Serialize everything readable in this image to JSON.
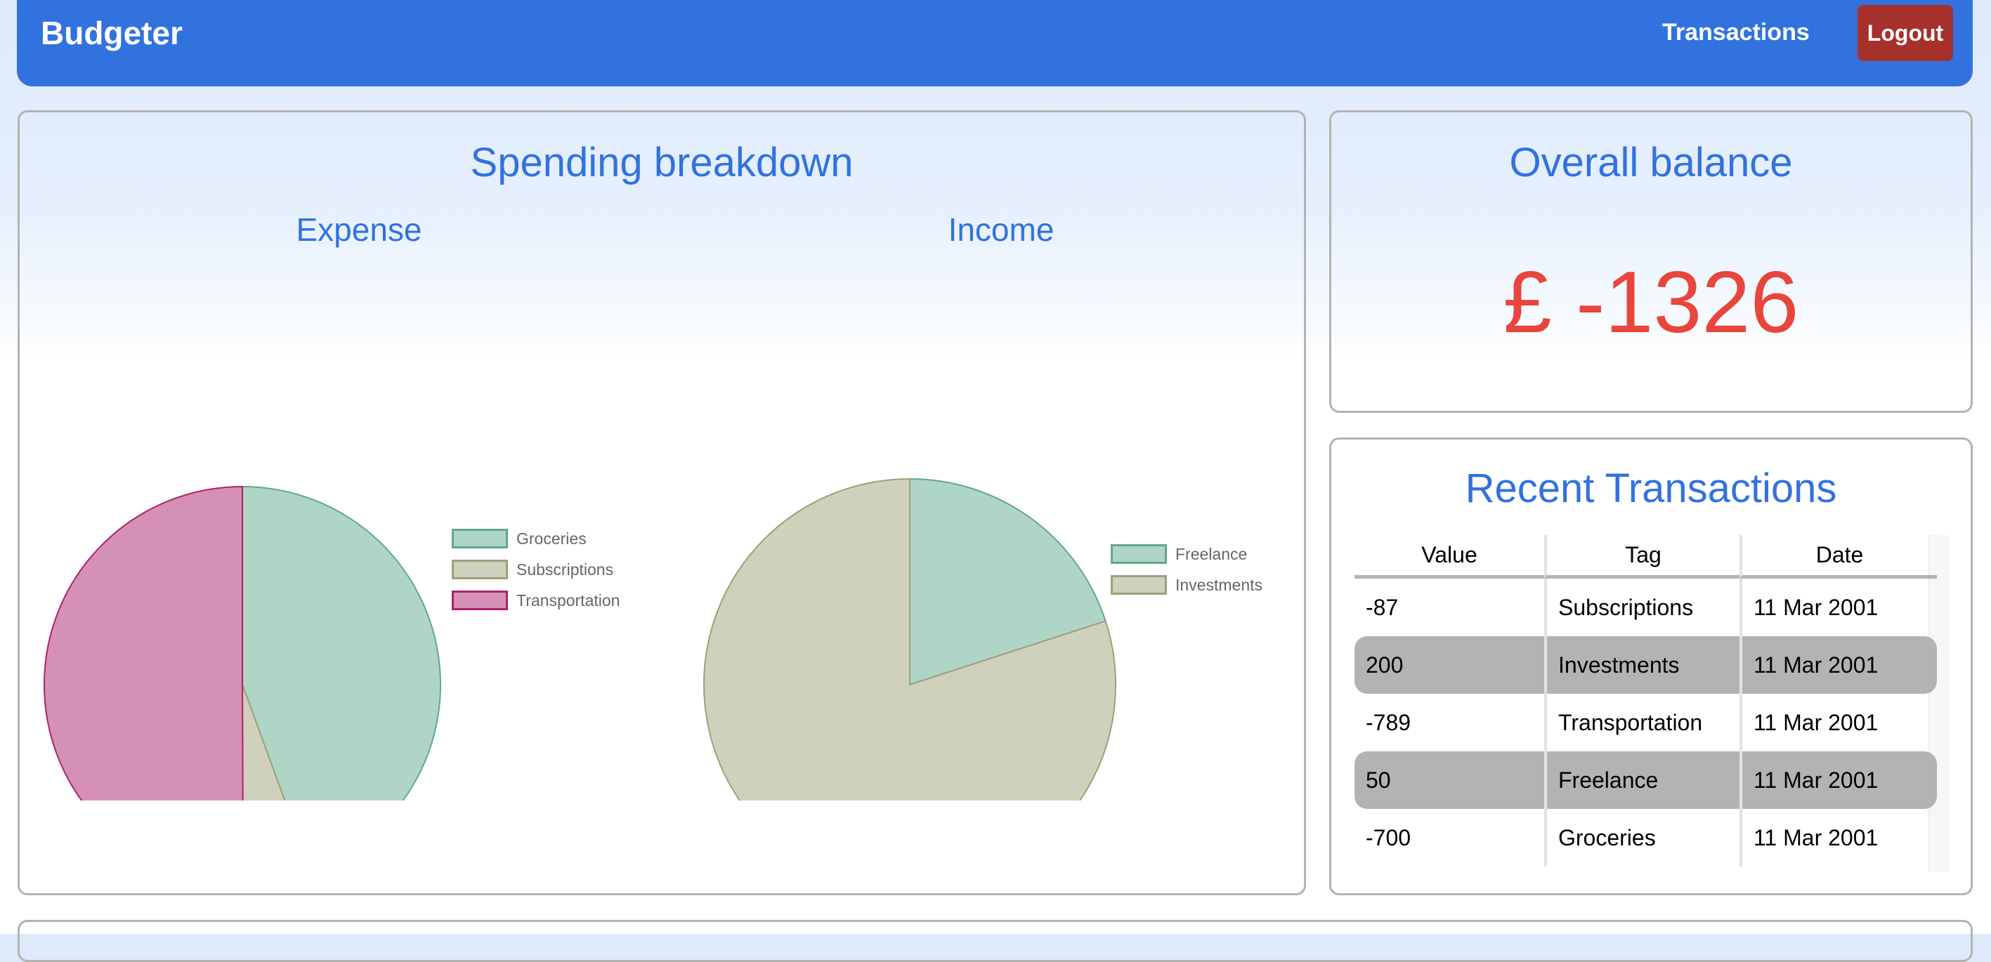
{
  "header": {
    "brand": "Budgeter",
    "nav_transactions": "Transactions",
    "logout": "Logout",
    "color": "#3272de",
    "logout_color": "#a6302b"
  },
  "spending": {
    "title": "Spending breakdown"
  },
  "balance": {
    "title": "Overall balance",
    "value": "£ -1326",
    "color": "#e8453c"
  },
  "recent": {
    "title": "Recent Transactions",
    "columns": [
      "Value",
      "Tag",
      "Date"
    ],
    "rows": [
      [
        "-87",
        "Subscriptions",
        "11 Mar 2001"
      ],
      [
        "200",
        "Investments",
        "11 Mar 2001"
      ],
      [
        "-789",
        "Transportation",
        "11 Mar 2001"
      ],
      [
        "50",
        "Freelance",
        "11 Mar 2001"
      ],
      [
        "-700",
        "Groceries",
        "11 Mar 2001"
      ]
    ]
  },
  "chart_data": [
    {
      "type": "pie",
      "title": "Expense",
      "categories": [
        "Groceries",
        "Subscriptions",
        "Transportation"
      ],
      "values": [
        700,
        87,
        789
      ],
      "colors": [
        "#afd5c6",
        "#cfd1bc",
        "#d591b5"
      ],
      "borders": [
        "#5fa88d",
        "#9ea07a",
        "#b0206a"
      ],
      "legend": "right"
    },
    {
      "type": "pie",
      "title": "Income",
      "categories": [
        "Freelance",
        "Investments"
      ],
      "values": [
        50,
        200
      ],
      "colors": [
        "#afd5c6",
        "#cfd1bc"
      ],
      "borders": [
        "#5fa88d",
        "#9ea07a"
      ],
      "legend": "right"
    }
  ]
}
